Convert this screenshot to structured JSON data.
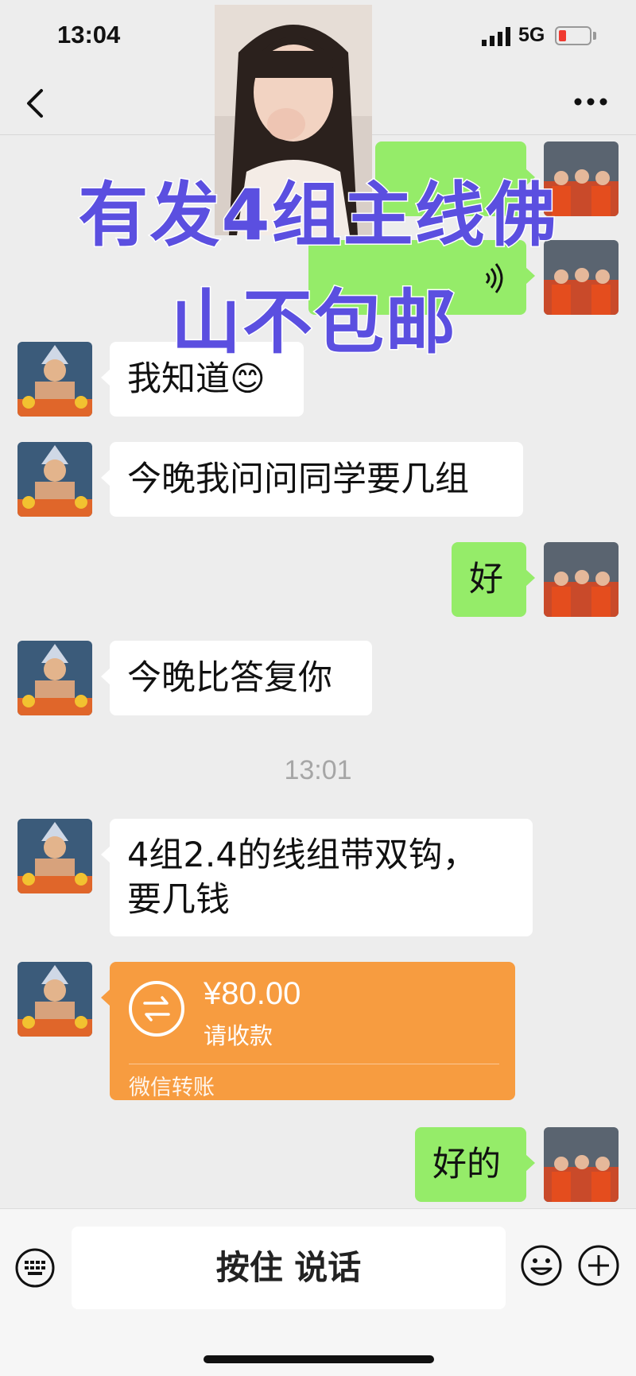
{
  "status_bar": {
    "time": "13:04",
    "network": "5G"
  },
  "watermark": {
    "line1": "有发4组主线佛",
    "line2": "山不包邮"
  },
  "messages": [
    {
      "text": "我知道😊"
    },
    {
      "text": "今晚我问问同学要几组"
    },
    {
      "text": "好"
    },
    {
      "text": "今晚比答复你"
    },
    {
      "text_line1": "4组2.4的线组带双钩，",
      "text_line2": "要几钱"
    },
    {
      "text": "好的"
    }
  ],
  "time_divider": "13:01",
  "transfer": {
    "amount": "¥80.00",
    "note": "请收款",
    "label": "微信转账"
  },
  "bottom_bar": {
    "voice_label": "按住 说话"
  },
  "colors": {
    "outgoing_bubble": "#95ec69",
    "incoming_bubble": "#ffffff",
    "transfer_bg": "#f79c40",
    "watermark": "#5b4fe0",
    "background": "#ededed"
  },
  "icons": [
    "signal-icon",
    "battery-icon",
    "back-icon",
    "more-icon",
    "keyboard-icon",
    "emoji-icon",
    "plus-icon",
    "transfer-icon"
  ]
}
